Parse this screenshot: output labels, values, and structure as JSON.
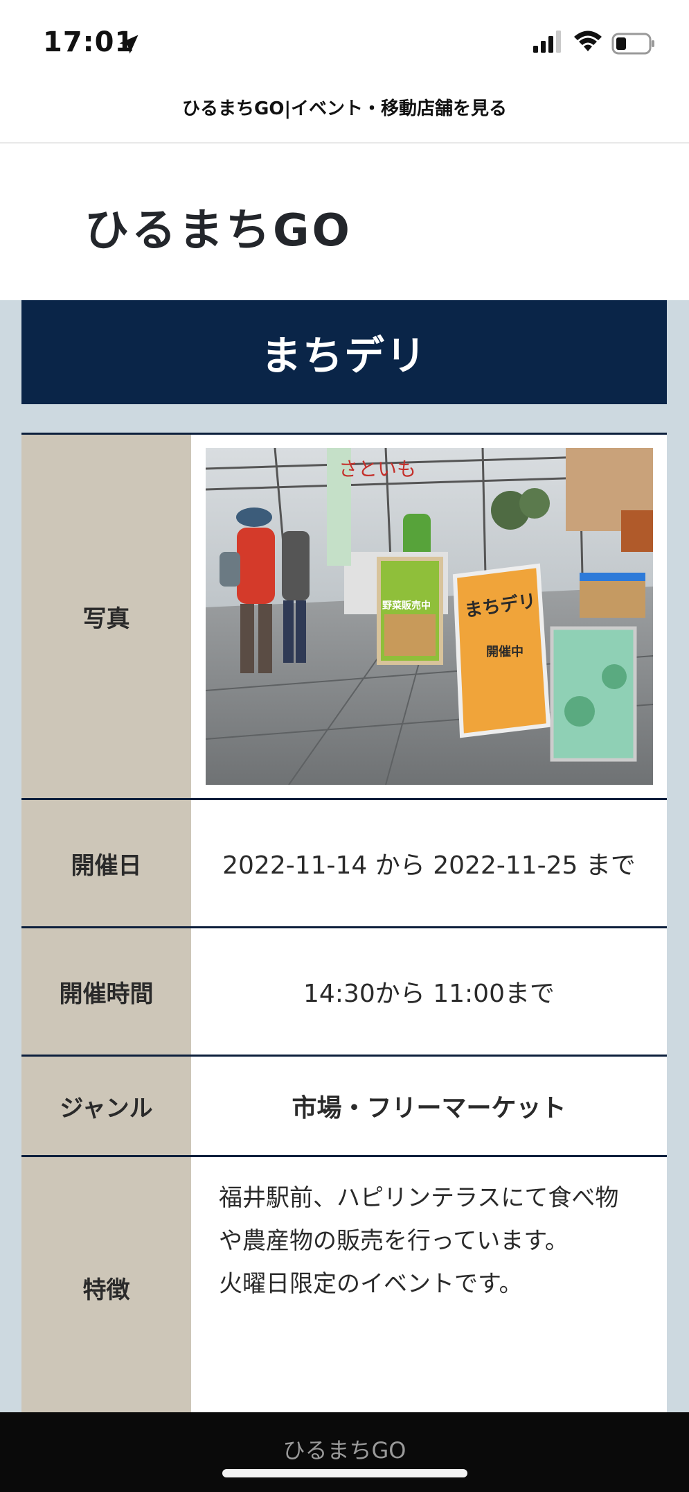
{
  "status_bar": {
    "time": "17:01"
  },
  "browser": {
    "title": "ひるまちGO|イベント・移動店舗を見る"
  },
  "site": {
    "logo": "ひるまちGO"
  },
  "event": {
    "name": "まちデリ",
    "rows": [
      {
        "label": "写真"
      },
      {
        "label": "開催日",
        "value": "2022-11-14 から 2022-11-25 まで"
      },
      {
        "label": "開催時間",
        "value": "14:30から 11:00まで"
      },
      {
        "label": "ジャンル",
        "value": "市場・フリーマーケット"
      },
      {
        "label": "特徴",
        "value": "福井駅前、ハピリンテラスにて食べ物や農産物の販売を行っています。\n火曜日限定のイベントです。"
      }
    ]
  },
  "photo": {
    "sign_text_1": "さといも",
    "sign_text_2": "野菜販売中",
    "sign_text_3": "まちデリ",
    "sign_text_4": "開催中"
  },
  "footer": {
    "title": "ひるまちGO"
  },
  "colors": {
    "navy": "#0a2548",
    "label_bg": "#cdc6b8",
    "content_bg": "#cdd9e0"
  }
}
